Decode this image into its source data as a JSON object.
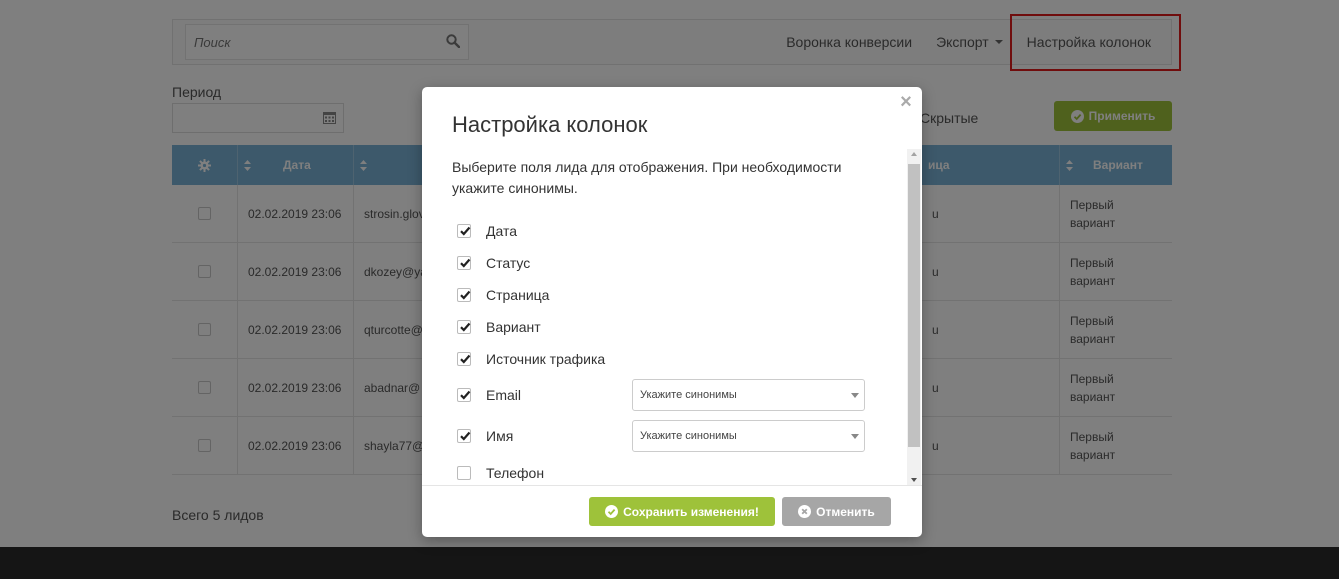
{
  "colors": {
    "accent_green": "#9ec23a",
    "table_header": "#7ab3d6",
    "highlight_red": "#e01b1b",
    "cancel_gray": "#a6a6a6",
    "footer_dark": "#2b2b2b"
  },
  "toolbar": {
    "search_placeholder": "Поиск",
    "search_icon": "search-icon",
    "funnel_label": "Воронка конверсии",
    "export_label": "Экспорт",
    "columns_label": "Настройка колонок"
  },
  "filters": {
    "period_label": "Период",
    "calendar_icon": "calendar-icon",
    "hidden_tab": "Скрытые",
    "apply_label": "Применить"
  },
  "table": {
    "header": {
      "settings_icon": "gear-icon",
      "date": "Дата",
      "page": "ица",
      "variant": "Вариант"
    },
    "rows": [
      {
        "date": "02.02.2019 23:06",
        "email": "strosin.glov",
        "page": "u",
        "variant": "Первый вариант"
      },
      {
        "date": "02.02.2019 23:06",
        "email": "dkozey@ya",
        "page": "u",
        "variant": "Первый вариант"
      },
      {
        "date": "02.02.2019 23:06",
        "email": "qturcotte@",
        "page": "u",
        "variant": "Первый вариант"
      },
      {
        "date": "02.02.2019 23:06",
        "email": "abadnar@",
        "page": "u",
        "variant": "Первый вариант"
      },
      {
        "date": "02.02.2019 23:06",
        "email": "shayla77@",
        "page": "u",
        "variant": "Первый вариант"
      }
    ]
  },
  "total_label": "Всего 5 лидов",
  "modal": {
    "close_glyph": "×",
    "title": "Настройка колонок",
    "description": "Выберите поля лида для отображения. При необходимости укажите синонимы.",
    "fields": [
      {
        "label": "Дата",
        "checked": true
      },
      {
        "label": "Статус",
        "checked": true
      },
      {
        "label": "Страница",
        "checked": true
      },
      {
        "label": "Вариант",
        "checked": true
      },
      {
        "label": "Источник трафика",
        "checked": true
      },
      {
        "label": "Email",
        "checked": true,
        "synonym_placeholder": "Укажите синонимы"
      },
      {
        "label": "Имя",
        "checked": true,
        "synonym_placeholder": "Укажите синонимы"
      },
      {
        "label": "Телефон",
        "checked": false
      }
    ],
    "save_label": "Сохранить изменения!",
    "cancel_label": "Отменить"
  }
}
